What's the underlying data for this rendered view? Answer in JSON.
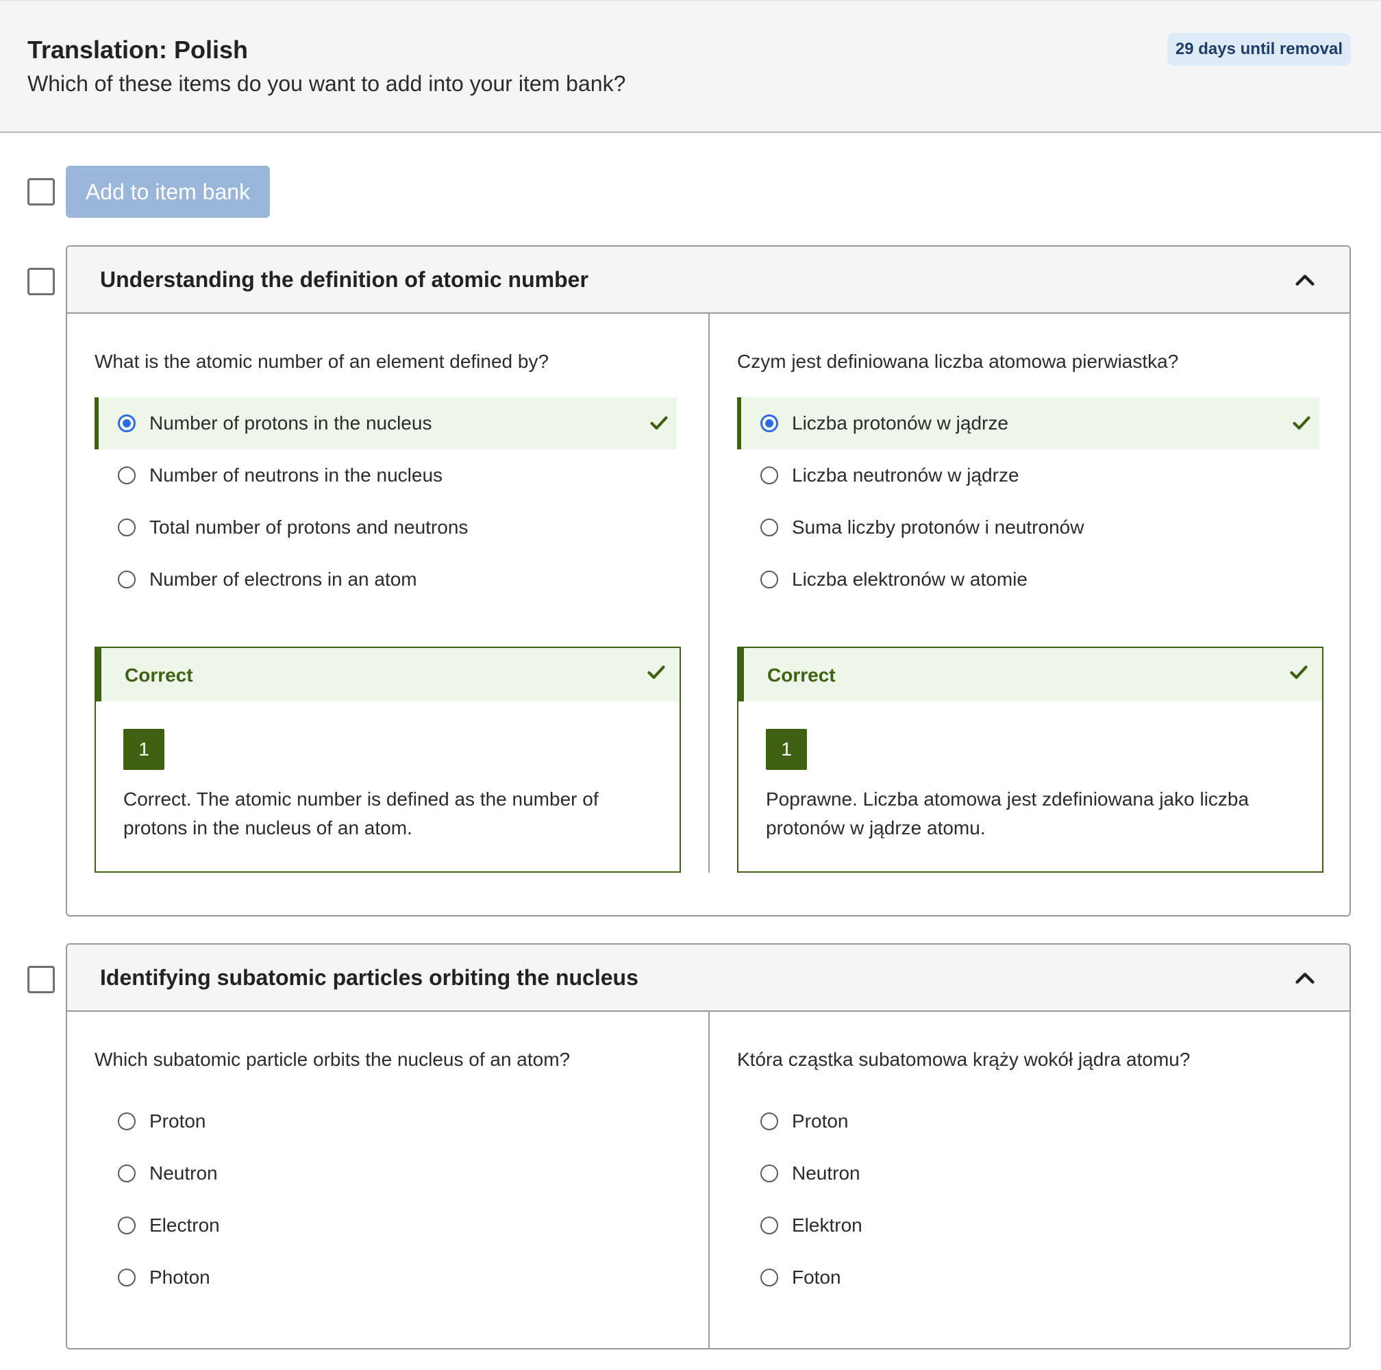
{
  "header": {
    "title": "Translation: Polish",
    "subtitle": "Which of these items do you want to add into your item bank?",
    "badge": "29 days until removal"
  },
  "toolbar": {
    "add_label": "Add to item bank"
  },
  "items": [
    {
      "title": "Understanding the definition of atomic number",
      "source": {
        "question": "What is the atomic number of an element defined by?",
        "options": [
          "Number of protons in the nucleus",
          "Number of neutrons in the nucleus",
          "Total number of protons and neutrons",
          "Number of electrons in an atom"
        ],
        "feedback_label": "Correct",
        "score": "1",
        "feedback_text": "Correct. The atomic number is defined as the number of protons in the nucleus of an atom."
      },
      "translation": {
        "question": "Czym jest definiowana liczba atomowa pierwiastka?",
        "options": [
          "Liczba protonów w jądrze",
          "Liczba neutronów w jądrze",
          "Suma liczby protonów i neutronów",
          "Liczba elektronów w atomie"
        ],
        "feedback_label": "Correct",
        "score": "1",
        "feedback_text": "Poprawne. Liczba atomowa jest zdefiniowana jako liczba protonów w jądrze atomu."
      }
    },
    {
      "title": "Identifying subatomic particles orbiting the nucleus",
      "source": {
        "question": "Which subatomic particle orbits the nucleus of an atom?",
        "options": [
          "Proton",
          "Neutron",
          "Electron",
          "Photon"
        ]
      },
      "translation": {
        "question": "Która cząstka subatomowa krąży wokół jądra atomu?",
        "options": [
          "Proton",
          "Neutron",
          "Elektron",
          "Foton"
        ]
      }
    }
  ],
  "colors": {
    "correct_green": "#3f6112",
    "correct_bg": "#eef5e9",
    "radio_selected": "#2b6be6",
    "button_disabled": "#9ab7da",
    "badge_bg": "#dfeaf7"
  }
}
